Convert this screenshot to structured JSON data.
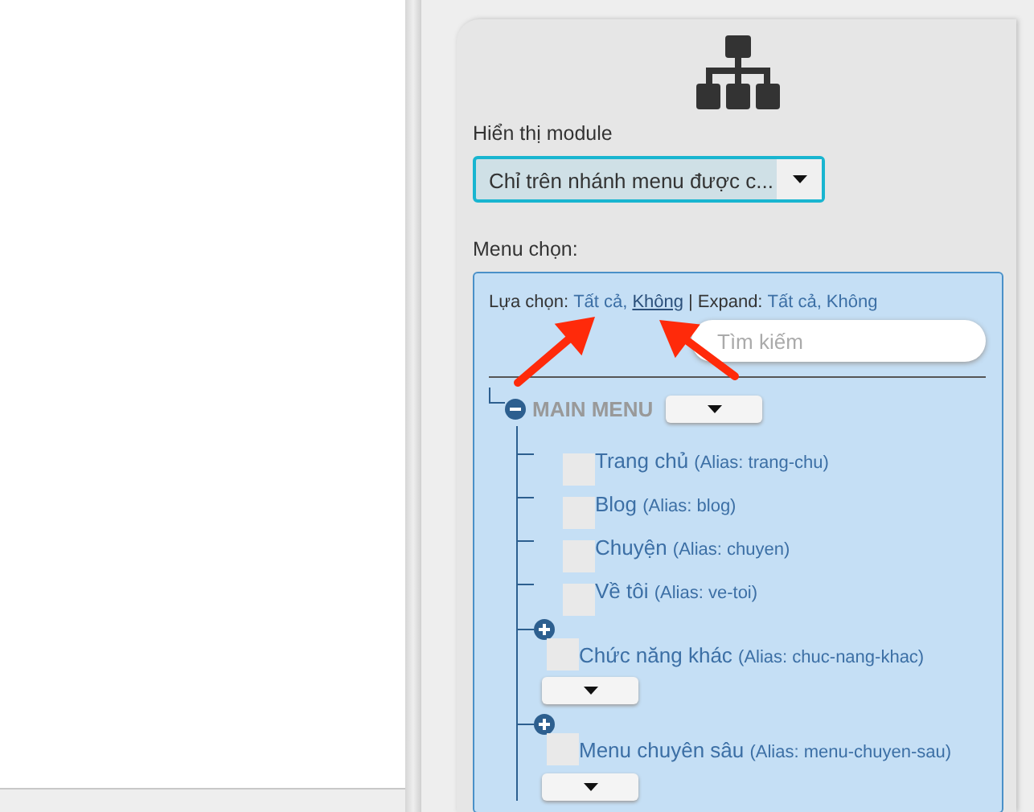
{
  "module_display": {
    "label": "Hiển thị module",
    "value": "Chỉ trên nhánh menu được c..."
  },
  "menu_select": {
    "label": "Menu chọn:",
    "options_line": [
      {
        "kind": "text",
        "text": "Lựa chọn:"
      },
      {
        "kind": "link",
        "text": "Tất cả,",
        "hovered": false
      },
      {
        "kind": "link",
        "text": "Không",
        "hovered": true
      },
      {
        "kind": "separator",
        "text": "|"
      },
      {
        "kind": "text",
        "text": "Expand:"
      },
      {
        "kind": "link",
        "text": "Tất cả,",
        "hovered": false
      },
      {
        "kind": "link",
        "text": "Không",
        "hovered": false
      }
    ],
    "search": {
      "placeholder": "Tìm kiếm"
    },
    "tree": {
      "title": "MAIN MENU",
      "expanded": true,
      "children": [
        {
          "kind": "item",
          "label": "Trang chủ",
          "alias": "(Alias: trang-chu)",
          "checked": false
        },
        {
          "kind": "item",
          "label": "Blog",
          "alias": "(Alias: blog)",
          "checked": false
        },
        {
          "kind": "item",
          "label": "Chuyện",
          "alias": "(Alias: chuyen)",
          "checked": false
        },
        {
          "kind": "item",
          "label": "Về tôi",
          "alias": "(Alias: ve-toi)",
          "checked": false
        },
        {
          "kind": "group",
          "label": "Chức năng khác",
          "alias": "(Alias: chuc-nang-khac)",
          "checked": false,
          "expanded": false
        },
        {
          "kind": "group",
          "label": "Menu chuyên sâu",
          "alias": "(Alias: menu-chuyen-sau)",
          "checked": false,
          "expanded": false
        }
      ]
    }
  }
}
